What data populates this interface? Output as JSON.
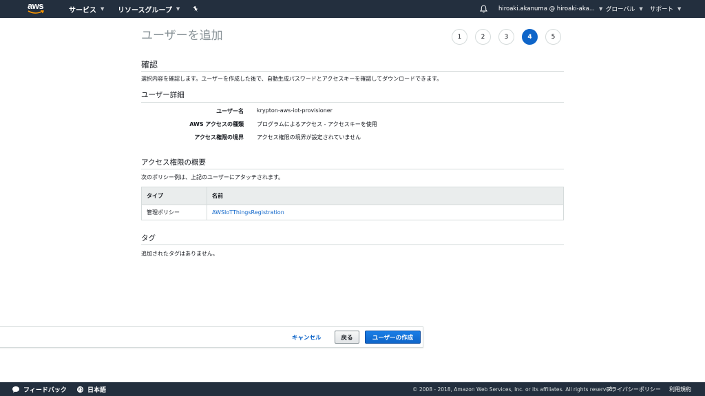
{
  "nav": {
    "logo_text": "aws",
    "services": "サービス",
    "resource_groups": "リソースグループ",
    "account": "hiroaki.akanuma @ hiroaki-aka...",
    "region": "グローバル",
    "support": "サポート"
  },
  "page": {
    "title": "ユーザーを追加",
    "steps": [
      "1",
      "2",
      "3",
      "4",
      "5"
    ]
  },
  "review": {
    "heading": "確認",
    "description": "選択内容を確認します。ユーザーを作成した後で、自動生成パスワードとアクセスキーを確認してダウンロードできます。"
  },
  "user_details": {
    "heading": "ユーザー詳細",
    "rows": [
      {
        "label": "ユーザー名",
        "value": "krypton-aws-iot-provisioner"
      },
      {
        "label": "AWS アクセスの種類",
        "value": "プログラムによるアクセス - アクセスキーを使用"
      },
      {
        "label": "アクセス権限の境界",
        "value": "アクセス権限の境界が設定されていません"
      }
    ]
  },
  "permissions": {
    "heading": "アクセス権限の概要",
    "description": "次のポリシー例は、上記のユーザーにアタッチされます。",
    "columns": [
      "タイプ",
      "名前"
    ],
    "rows": [
      {
        "type": "管理ポリシー",
        "name": "AWSIoTThingsRegistration"
      }
    ]
  },
  "tags": {
    "heading": "タグ",
    "empty": "追加されたタグはありません。"
  },
  "actions": {
    "cancel": "キャンセル",
    "back": "戻る",
    "create": "ユーザーの作成"
  },
  "footer": {
    "feedback": "フィードバック",
    "language": "日本語",
    "copyright": "© 2008 - 2018, Amazon Web Services, Inc. or its affiliates. All rights reserved.",
    "privacy": "プライバシーポリシー",
    "terms": "利用規約"
  },
  "colors": {
    "nav_bg": "#232f3e",
    "accent": "#0e65c9"
  }
}
